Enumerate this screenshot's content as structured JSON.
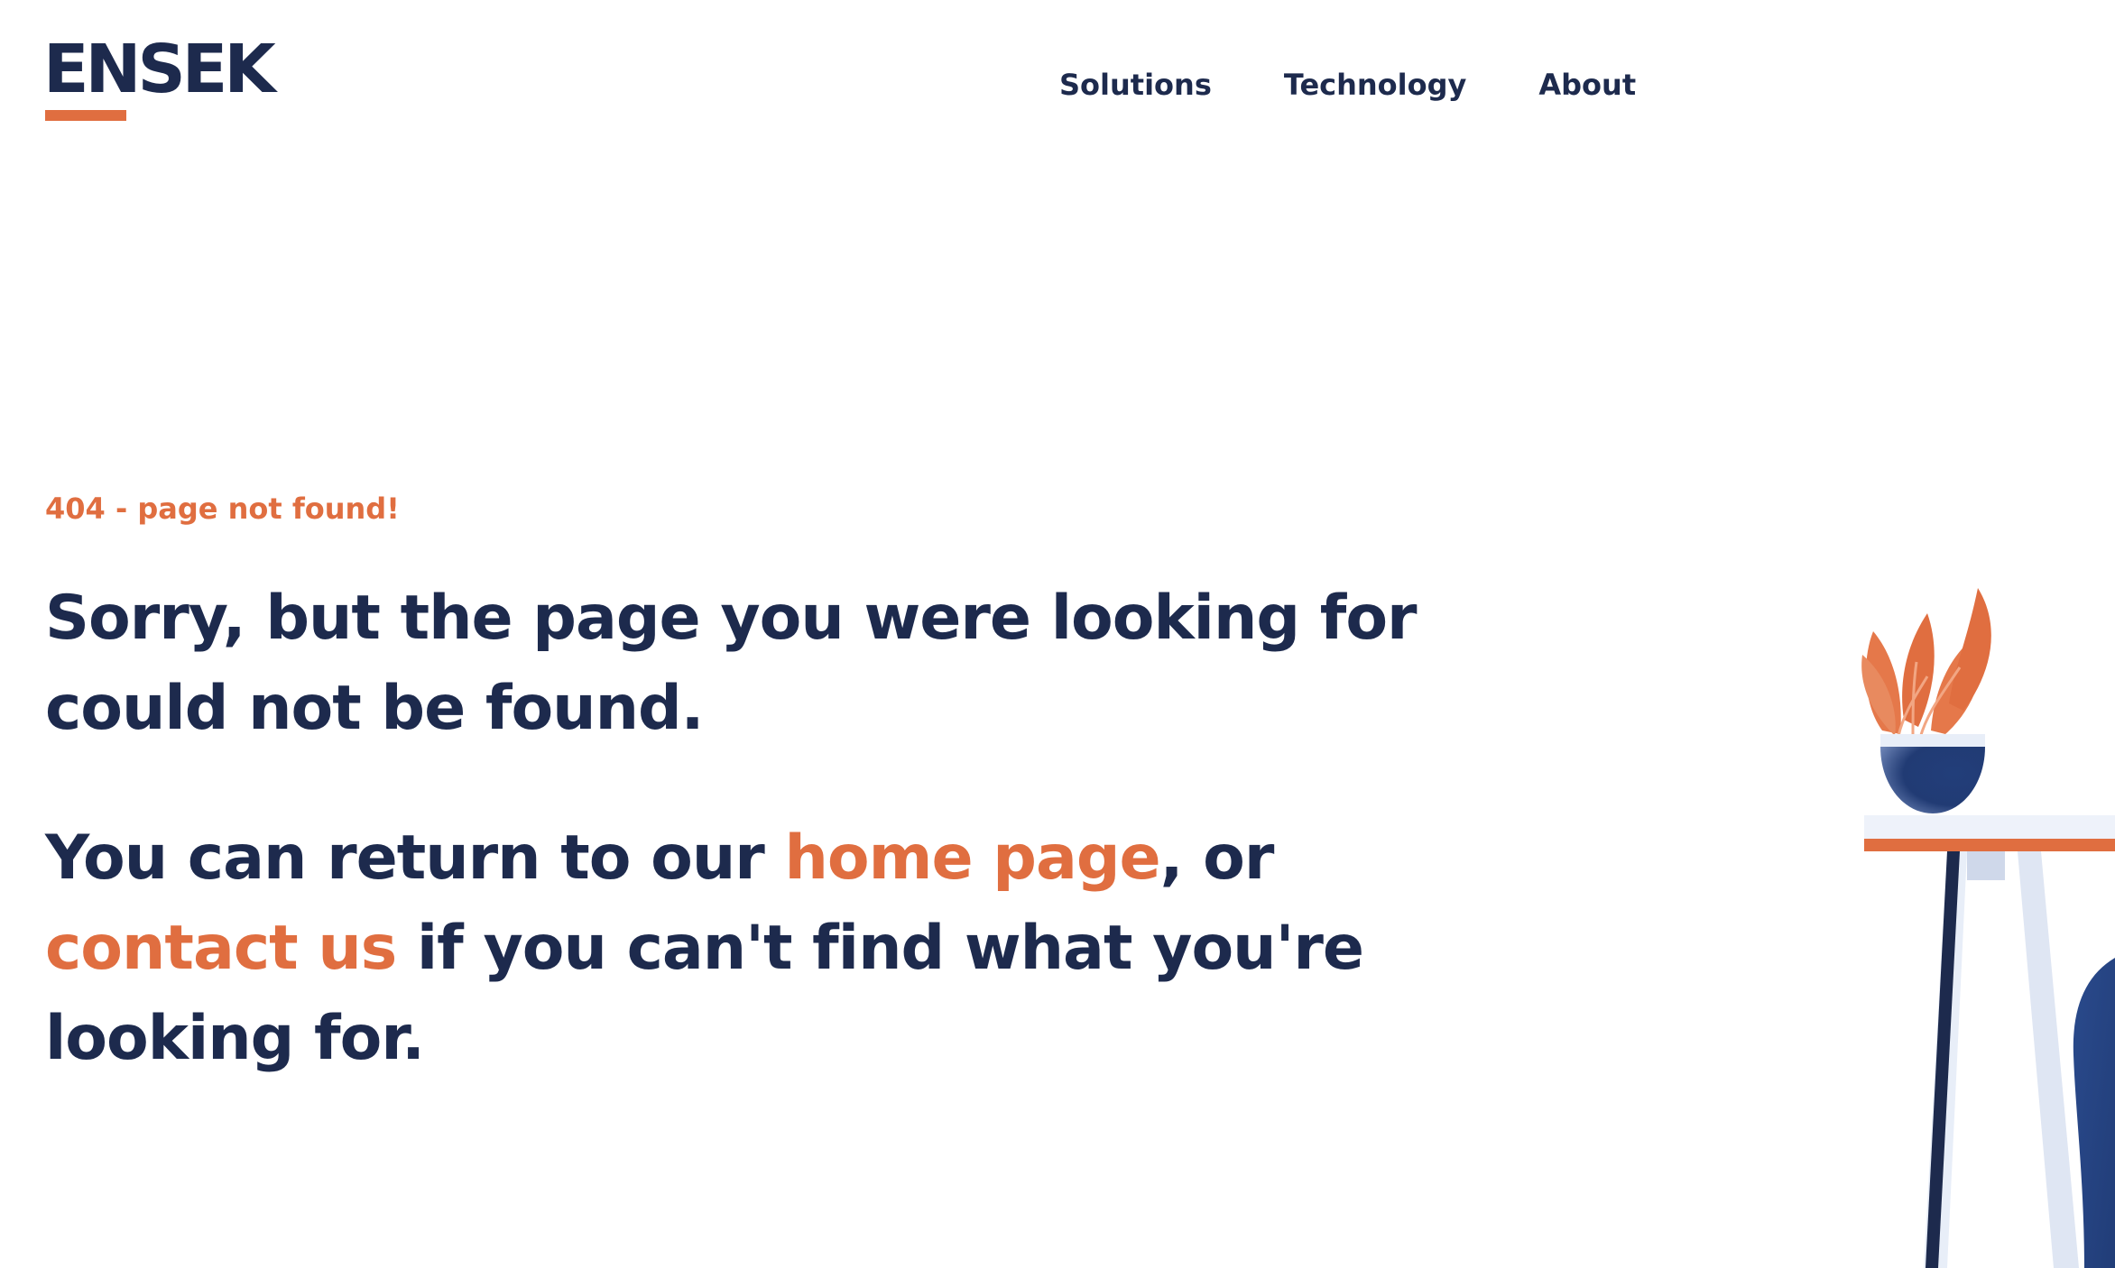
{
  "brand": {
    "logo_text": "ENSEK",
    "colors": {
      "navy": "#1d2a4d",
      "orange": "#e06e40",
      "pot_blue": "#213d78",
      "light_table": "#e8eef8"
    }
  },
  "nav": {
    "items": [
      {
        "label": "Solutions"
      },
      {
        "label": "Technology"
      },
      {
        "label": "About"
      }
    ]
  },
  "main": {
    "eyebrow": "404 - page not found!",
    "headline": "Sorry, but the page you were looking for could not be found.",
    "sub": {
      "part1": "You can return to our ",
      "home_link": "home page",
      "part2": ", or ",
      "contact_link": "contact us",
      "part3": " if you can't find what you're looking for."
    }
  },
  "illustration": {
    "icons": [
      "plant-icon",
      "pot-icon",
      "side-table-icon",
      "chair-icon"
    ]
  }
}
